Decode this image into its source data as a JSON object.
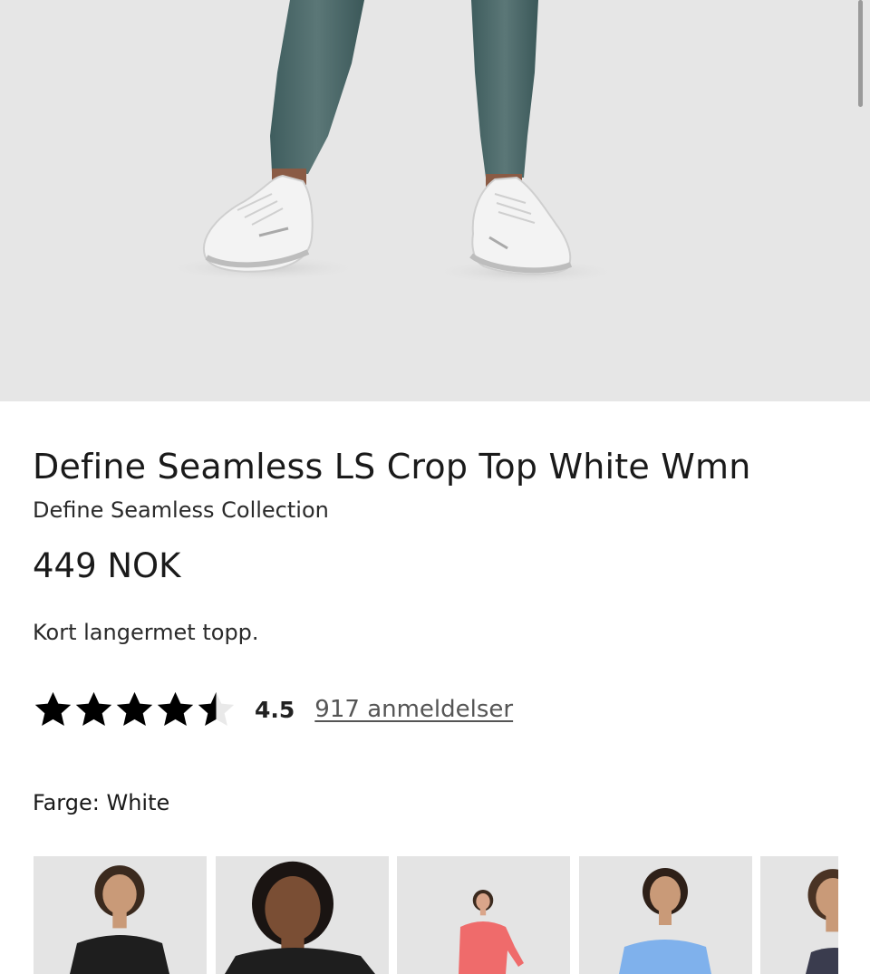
{
  "hero_image": {
    "alt": "product-photo-legs-and-sneakers"
  },
  "product": {
    "title": "Define Seamless LS Crop Top White Wmn",
    "collection": "Define Seamless Collection",
    "price": "449 NOK",
    "short_description": "Kort langermet topp.",
    "rating": {
      "value": 4.5,
      "value_label": "4.5",
      "max": 5,
      "reviews_label": "917 anmeldelser"
    },
    "color_label": "Farge: White"
  },
  "swatches": [
    {
      "name": "black-model-1",
      "top_color": "#1e1e1e",
      "skin": "#c99a78",
      "hair": "#3b2a1e"
    },
    {
      "name": "black-model-2",
      "top_color": "#1e1e1e",
      "skin": "#7a4e34",
      "hair": "#1a1412"
    },
    {
      "name": "coral",
      "top_color": "#ef6b6b",
      "skin": "#d9a58a",
      "hair": "#3b2a1e"
    },
    {
      "name": "light-blue",
      "top_color": "#7fb1ec",
      "skin": "#c99a78",
      "hair": "#2e2018"
    },
    {
      "name": "dark-navy",
      "top_color": "#3a3c4e",
      "skin": "#c99a78",
      "hair": "#4a3324"
    }
  ]
}
